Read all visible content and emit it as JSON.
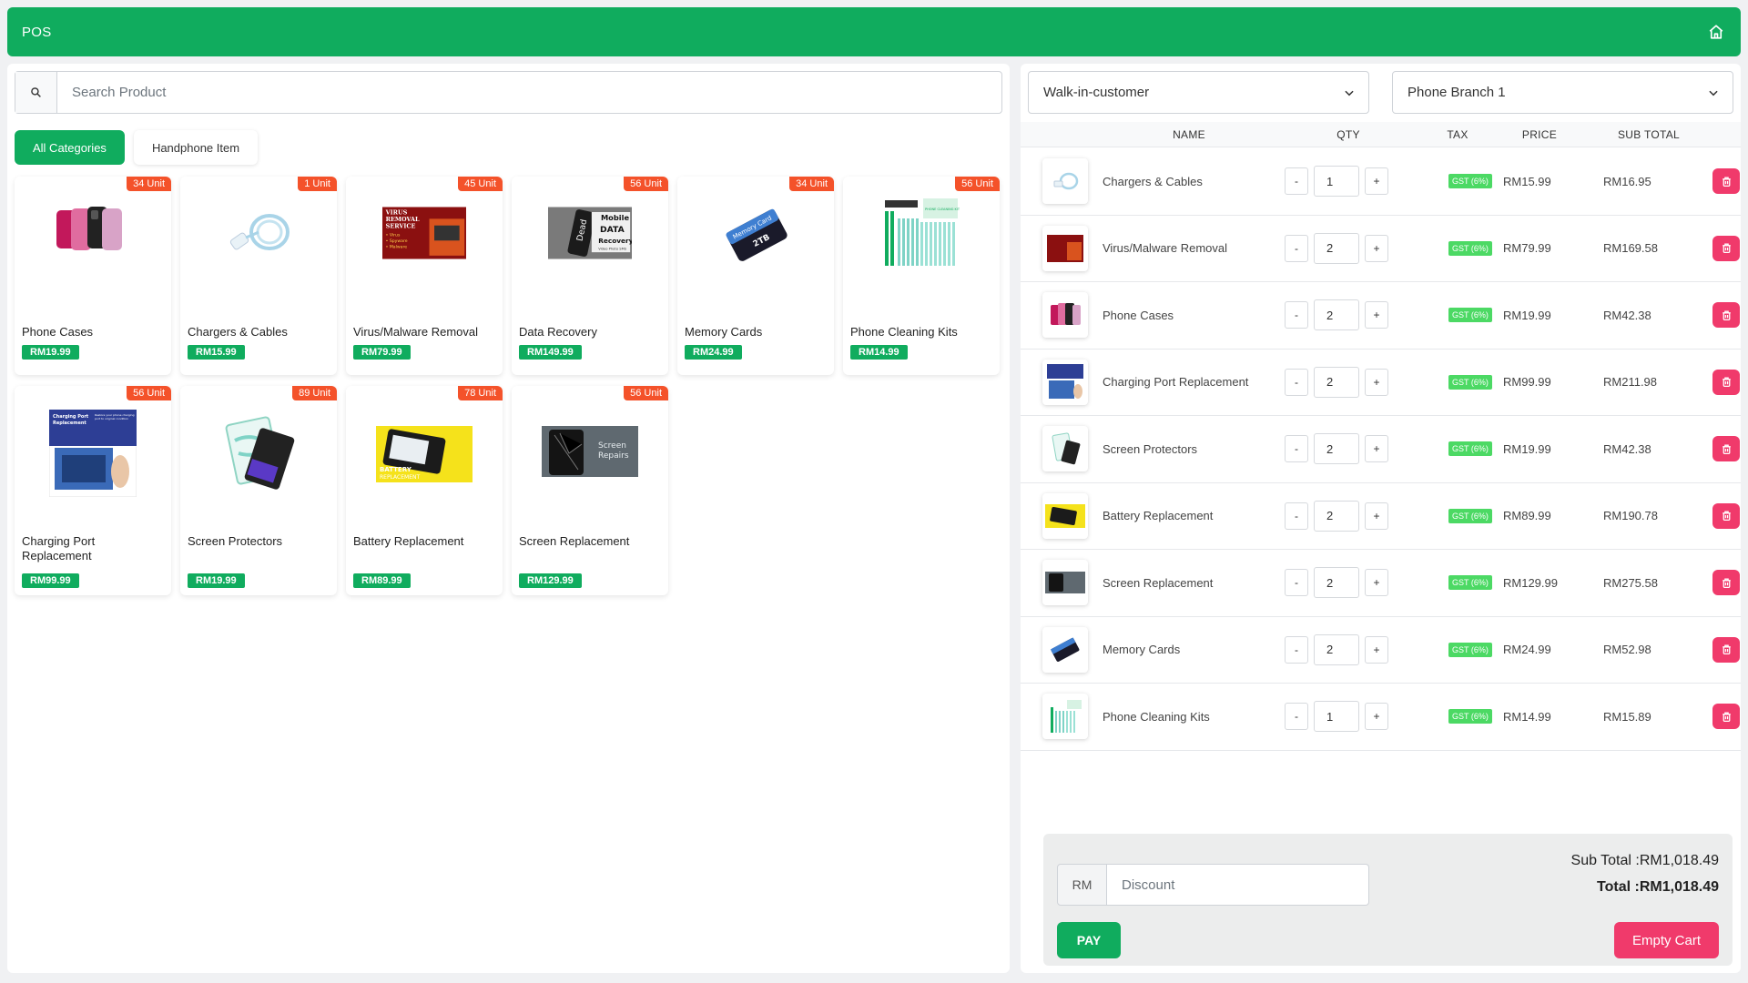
{
  "app": {
    "title": "POS"
  },
  "search": {
    "placeholder": "Search Product"
  },
  "categories": [
    {
      "label": "All Categories",
      "active": true
    },
    {
      "label": "Handphone Item",
      "active": false
    }
  ],
  "products": [
    {
      "name": "Phone Cases",
      "price": "RM19.99",
      "stock": "34 Unit"
    },
    {
      "name": "Chargers & Cables",
      "price": "RM15.99",
      "stock": "1 Unit"
    },
    {
      "name": "Virus/Malware Removal",
      "price": "RM79.99",
      "stock": "45 Unit"
    },
    {
      "name": "Data Recovery",
      "price": "RM149.99",
      "stock": "56 Unit"
    },
    {
      "name": "Memory Cards",
      "price": "RM24.99",
      "stock": "34 Unit"
    },
    {
      "name": "Phone Cleaning Kits",
      "price": "RM14.99",
      "stock": "56 Unit"
    },
    {
      "name": "Charging Port Replacement",
      "price": "RM99.99",
      "stock": "56 Unit"
    },
    {
      "name": "Screen Protectors",
      "price": "RM19.99",
      "stock": "89 Unit"
    },
    {
      "name": "Battery Replacement",
      "price": "RM89.99",
      "stock": "78 Unit"
    },
    {
      "name": "Screen Replacement",
      "price": "RM129.99",
      "stock": "56 Unit"
    }
  ],
  "product_image_text": {
    "virus": [
      "VIRUS",
      "REMOVAL",
      "SERVICE",
      "• Virus",
      "• Spyware",
      "• Malware"
    ],
    "data": [
      "Mobile",
      "DATA",
      "Recovery",
      "Dead",
      "Video Photo SMS"
    ],
    "memory": [
      "Memory Card",
      "2TB"
    ],
    "cleaning": "PHONE CLEANING KIT",
    "charging": [
      "Charging Port",
      "Replacement",
      "Restore your phone charging port to original condition"
    ],
    "battery": [
      "BATTERY",
      "REPLACEMENT"
    ],
    "screen": [
      "Screen",
      "Repairs"
    ]
  },
  "customer_select": {
    "value": "Walk-in-customer"
  },
  "branch_select": {
    "value": "Phone Branch 1"
  },
  "cart_headers": {
    "name": "NAME",
    "qty": "QTY",
    "tax": "TAX",
    "price": "PRICE",
    "subtotal": "SUB TOTAL"
  },
  "cart_items": [
    {
      "name": "Chargers & Cables",
      "qty": "1",
      "tax": "GST (6%)",
      "price": "RM15.99",
      "subtotal": "RM16.95"
    },
    {
      "name": "Virus/Malware Removal",
      "qty": "2",
      "tax": "GST (6%)",
      "price": "RM79.99",
      "subtotal": "RM169.58"
    },
    {
      "name": "Phone Cases",
      "qty": "2",
      "tax": "GST (6%)",
      "price": "RM19.99",
      "subtotal": "RM42.38"
    },
    {
      "name": "Charging Port Replacement",
      "qty": "2",
      "tax": "GST (6%)",
      "price": "RM99.99",
      "subtotal": "RM211.98"
    },
    {
      "name": "Screen Protectors",
      "qty": "2",
      "tax": "GST (6%)",
      "price": "RM19.99",
      "subtotal": "RM42.38"
    },
    {
      "name": "Battery Replacement",
      "qty": "2",
      "tax": "GST (6%)",
      "price": "RM89.99",
      "subtotal": "RM190.78"
    },
    {
      "name": "Screen Replacement",
      "qty": "2",
      "tax": "GST (6%)",
      "price": "RM129.99",
      "subtotal": "RM275.58"
    },
    {
      "name": "Memory Cards",
      "qty": "2",
      "tax": "GST (6%)",
      "price": "RM24.99",
      "subtotal": "RM52.98"
    },
    {
      "name": "Phone Cleaning Kits",
      "qty": "1",
      "tax": "GST (6%)",
      "price": "RM14.99",
      "subtotal": "RM15.89"
    }
  ],
  "qty_controls": {
    "minus": "-",
    "plus": "+"
  },
  "discount": {
    "currency": "RM",
    "placeholder": "Discount"
  },
  "totals": {
    "subtotal": "Sub Total :RM1,018.49",
    "total": "Total :RM1,018.49"
  },
  "buttons": {
    "pay": "PAY",
    "empty_cart": "Empty Cart"
  },
  "colors": {
    "primary": "#10ac5e",
    "danger": "#f03a6b",
    "stock_badge": "#f4522a",
    "tax_badge": "#4cd964"
  }
}
